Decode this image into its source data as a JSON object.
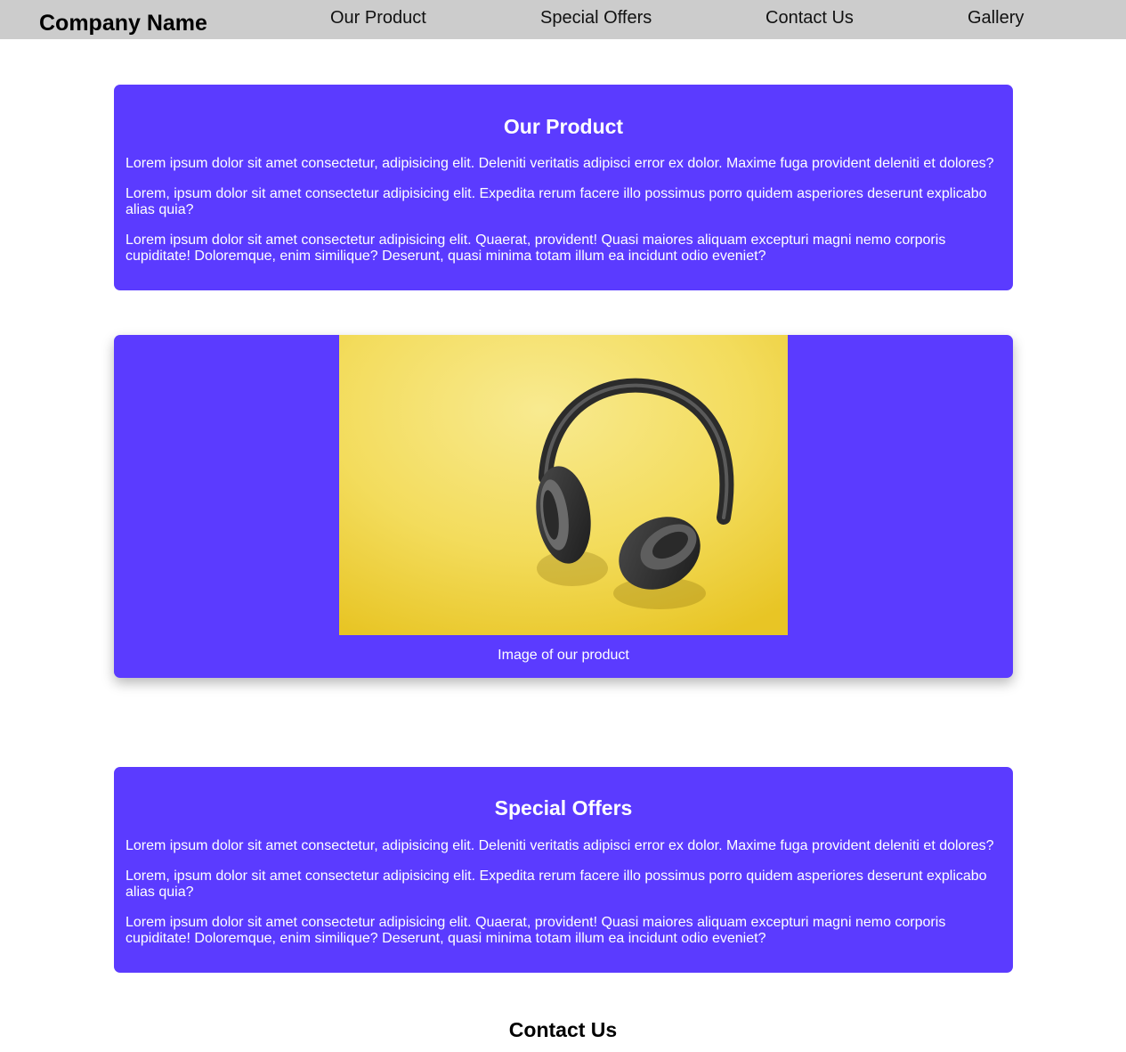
{
  "header": {
    "brand": "Company Name",
    "nav": [
      {
        "label": "Our Product"
      },
      {
        "label": "Special Offers"
      },
      {
        "label": "Contact Us"
      },
      {
        "label": "Gallery"
      }
    ]
  },
  "product": {
    "title": "Our Product",
    "paragraphs": [
      "Lorem ipsum dolor sit amet consectetur, adipisicing elit. Deleniti veritatis adipisci error ex dolor. Maxime fuga provident deleniti et dolores?",
      "Lorem, ipsum dolor sit amet consectetur adipisicing elit. Expedita rerum facere illo possimus porro quidem asperiores deserunt explicabo alias quia?",
      "Lorem ipsum dolor sit amet consectetur adipisicing elit. Quaerat, provident! Quasi maiores aliquam excepturi magni nemo corporis cupiditate! Doloremque, enim similique? Deserunt, quasi minima totam illum ea incidunt odio eveniet?"
    ]
  },
  "product_image": {
    "caption": "Image of our product",
    "icon": "headphones-photo"
  },
  "offers": {
    "title": "Special Offers",
    "paragraphs": [
      "Lorem ipsum dolor sit amet consectetur, adipisicing elit. Deleniti veritatis adipisci error ex dolor. Maxime fuga provident deleniti et dolores?",
      "Lorem, ipsum dolor sit amet consectetur adipisicing elit. Expedita rerum facere illo possimus porro quidem asperiores deserunt explicabo alias quia?",
      "Lorem ipsum dolor sit amet consectetur adipisicing elit. Quaerat, provident! Quasi maiores aliquam excepturi magni nemo corporis cupiditate! Doloremque, enim similique? Deserunt, quasi minima totam illum ea incidunt odio eveniet?"
    ]
  },
  "contact": {
    "title": "Contact Us"
  },
  "colors": {
    "nav_background": "#cccccc",
    "card_background": "#5b3bff",
    "photo_background": "#f5d63a"
  }
}
